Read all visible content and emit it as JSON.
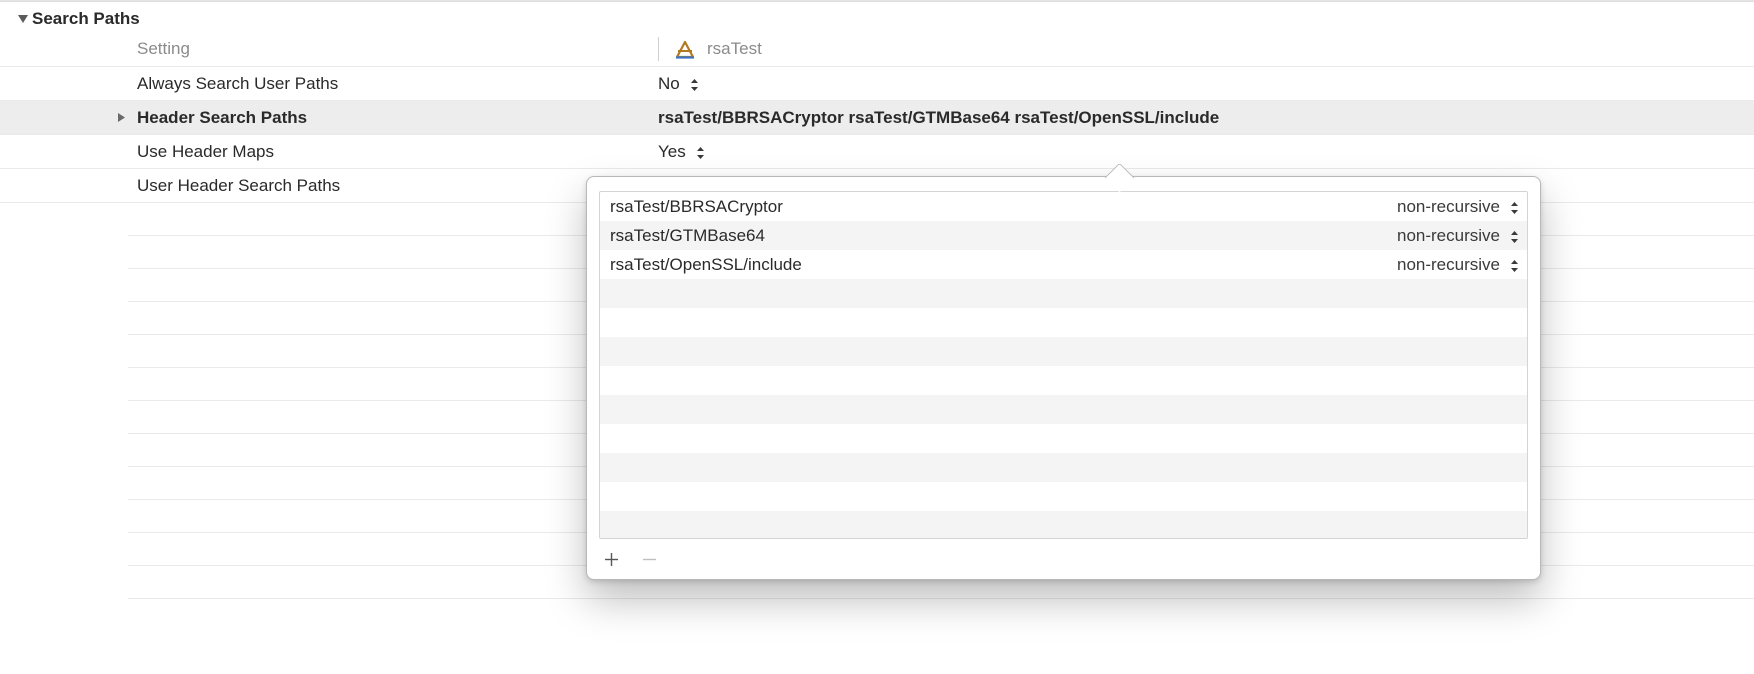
{
  "section": {
    "title": "Search Paths"
  },
  "columns": {
    "setting": "Setting",
    "target": "rsaTest"
  },
  "rows": [
    {
      "label": "Always Search User Paths",
      "value": "No",
      "stepper": true,
      "selected": false,
      "chevron": false
    },
    {
      "label": "Header Search Paths",
      "value": "rsaTest/BBRSACryptor rsaTest/GTMBase64 rsaTest/OpenSSL/include",
      "stepper": false,
      "selected": true,
      "chevron": true
    },
    {
      "label": "Use Header Maps",
      "value": "Yes",
      "stepper": true,
      "selected": false,
      "chevron": false
    },
    {
      "label": "User Header Search Paths",
      "value": "",
      "stepper": false,
      "selected": false,
      "chevron": false
    }
  ],
  "popover": {
    "entries": [
      {
        "path": "rsaTest/BBRSACryptor",
        "mode": "non-recursive"
      },
      {
        "path": "rsaTest/GTMBase64",
        "mode": "non-recursive"
      },
      {
        "path": "rsaTest/OpenSSL/include",
        "mode": "non-recursive"
      }
    ],
    "total_rows": 12,
    "buttons": {
      "add": "+",
      "remove": "−"
    }
  }
}
